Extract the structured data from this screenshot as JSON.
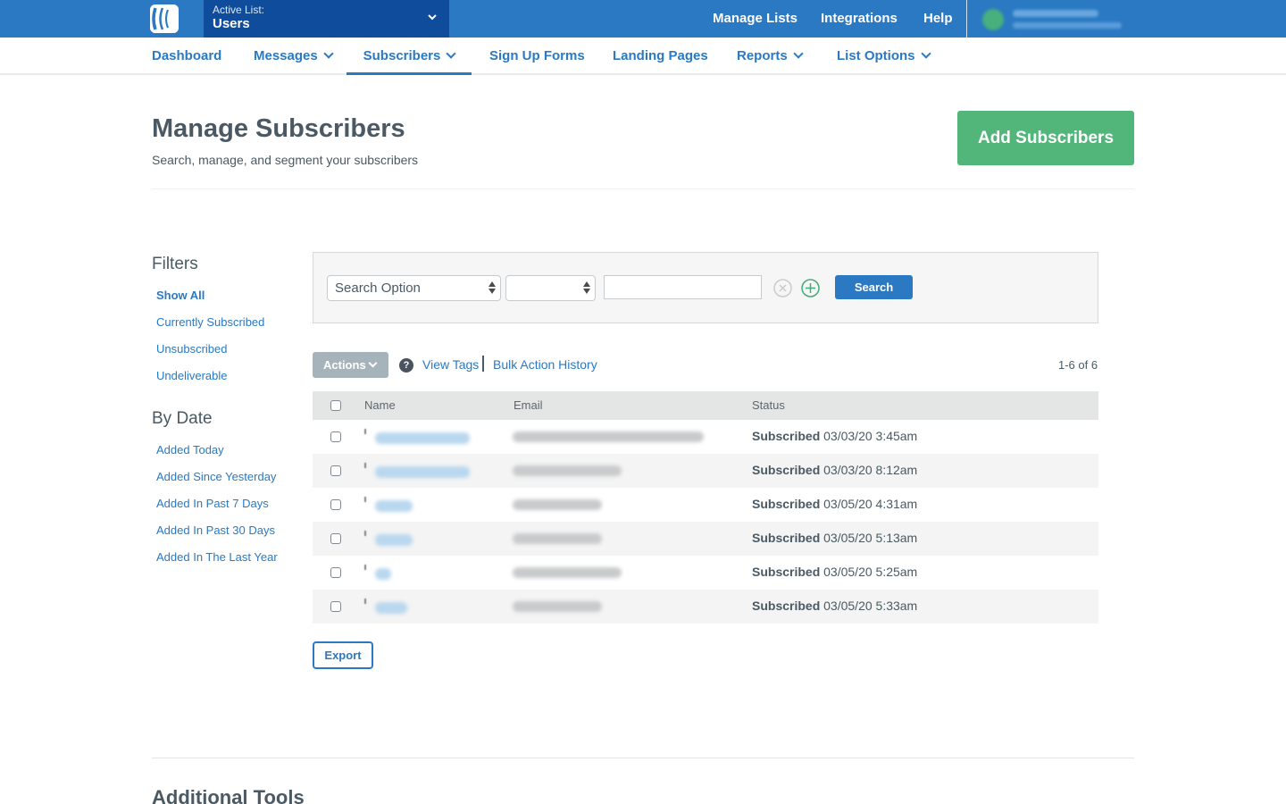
{
  "topbar": {
    "logo": "app-logo-icon",
    "active_list_label": "Active List:",
    "active_list_value": "Users",
    "links": [
      "Manage Lists",
      "Integrations",
      "Help"
    ],
    "user": "redacted"
  },
  "nav": {
    "items": [
      {
        "label": "Dashboard",
        "dropdown": false,
        "active": false
      },
      {
        "label": "Messages",
        "dropdown": true,
        "active": false
      },
      {
        "label": "Subscribers",
        "dropdown": true,
        "active": true
      },
      {
        "label": "Sign Up Forms",
        "dropdown": false,
        "active": false
      },
      {
        "label": "Landing Pages",
        "dropdown": false,
        "active": false
      },
      {
        "label": "Reports",
        "dropdown": true,
        "active": false
      },
      {
        "label": "List Options",
        "dropdown": true,
        "active": false
      }
    ]
  },
  "page": {
    "title": "Manage Subscribers",
    "subtitle": "Search, manage, and segment your subscribers",
    "add_button": "Add Subscribers"
  },
  "filters": {
    "heading": "Filters",
    "items": [
      "Show All",
      "Currently Subscribed",
      "Unsubscribed",
      "Undeliverable"
    ],
    "by_date_heading": "By Date",
    "date_items": [
      "Added Today",
      "Added Since Yesterday",
      "Added In Past 7 Days",
      "Added In Past 30 Days",
      "Added In The Last Year"
    ]
  },
  "search": {
    "option_select": "Search Option",
    "operator_select": "",
    "input_value": "",
    "search_button": "Search"
  },
  "toolbar": {
    "actions_label": "Actions",
    "help_glyph": "?",
    "view_tags": "View Tags",
    "bulk_history": "Bulk Action History",
    "count": "1-6 of 6"
  },
  "table": {
    "headers": [
      "Name",
      "Email",
      "Status"
    ],
    "rows": [
      {
        "name": "redacted",
        "email": "redacted",
        "status": "Subscribed",
        "date": "03/03/20 3:45am"
      },
      {
        "name": "redacted",
        "email": "redacted",
        "status": "Subscribed",
        "date": "03/03/20 8:12am"
      },
      {
        "name": "redacted",
        "email": "redacted",
        "status": "Subscribed",
        "date": "03/05/20 4:31am"
      },
      {
        "name": "redacted",
        "email": "redacted",
        "status": "Subscribed",
        "date": "03/05/20 5:13am"
      },
      {
        "name": "redacted",
        "email": "redacted",
        "status": "Subscribed",
        "date": "03/05/20 5:25am"
      },
      {
        "name": "redacted",
        "email": "redacted",
        "status": "Subscribed",
        "date": "03/05/20 5:33am"
      }
    ]
  },
  "export_button": "Export",
  "additional_tools_title": "Additional Tools",
  "colors": {
    "brand_blue": "#2a79c2",
    "active_list_bg": "#0f4d9c",
    "add_green": "#52b67b",
    "actions_gray": "#a7b3bb"
  }
}
